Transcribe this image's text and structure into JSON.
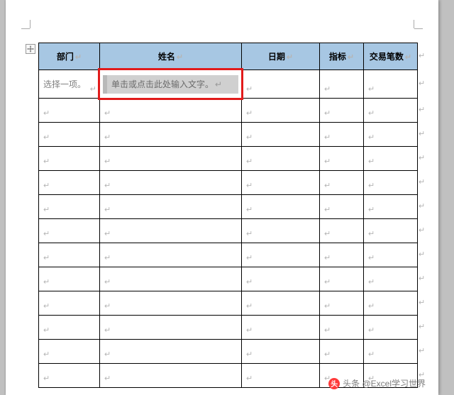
{
  "table": {
    "headers": {
      "dept": "部门",
      "name": "姓名",
      "date": "日期",
      "index": "指标",
      "count": "交易笔数"
    },
    "first_row": {
      "dept_text": "选择一项。",
      "name_placeholder": "单击或点击此处输入文字。"
    },
    "empty_rows": 12,
    "paragraph_mark": "↵"
  },
  "watermark": {
    "logo_text": "头",
    "text": "头条 @Excel学习世界"
  }
}
